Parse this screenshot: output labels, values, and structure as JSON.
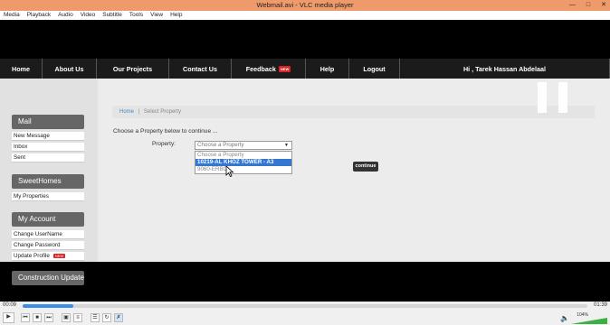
{
  "window": {
    "title": "Webmail.avi - VLC media player",
    "min_icon": "minimize-icon",
    "max_icon": "maximize-icon",
    "close_icon": "close-icon"
  },
  "menubar": [
    "Media",
    "Playback",
    "Audio",
    "Video",
    "Subtitle",
    "Tools",
    "View",
    "Help"
  ],
  "site": {
    "nav": {
      "home": "Home",
      "about": "About Us",
      "projects": "Our Projects",
      "contact": "Contact Us",
      "feedback": "Feedback",
      "feedback_badge": "NEW",
      "help": "Help",
      "logout": "Logout",
      "greeting": "Hi , Tarek Hassan Abdelaal"
    },
    "sidebar": {
      "mail_head": "Mail",
      "mail_links": [
        "New Message",
        "Inbox",
        "Sent"
      ],
      "homes_head": "SweetHomes",
      "homes_links": [
        "My Properties"
      ],
      "account_head": "My Account",
      "account_links": [
        "Change UserName",
        "Change Password",
        "Update Profile"
      ],
      "update_badge": "NEW",
      "construction_head": "Construction Update"
    },
    "breadcrumb": {
      "home": "Home",
      "sep": "|",
      "current": "Select Property"
    },
    "prompt": "Choose a Property below to continue ...",
    "property_label": "Property:",
    "select_value": "Choose a Property",
    "options": [
      "Choose a Property",
      "10219-AL KHOZ TOWER - A3",
      "9060-ERBC..."
    ],
    "selected_index": 1,
    "continue_label": "continue"
  },
  "player": {
    "elapsed": "00:09",
    "total": "01:39",
    "progress": 0.09,
    "volume_label": "104%",
    "volume": 1.04,
    "buttons": [
      "play-icon",
      "previous-icon",
      "stop-icon",
      "next-icon",
      "fullscreen-icon",
      "extended-settings-icon",
      "playlist-icon",
      "loop-icon",
      "shuffle-icon"
    ],
    "accent": "#3a8ee6"
  },
  "colors": {
    "titlebar": "#ef9a6a",
    "nav_bg": "#1b1b1b",
    "badge_red": "#d8232a",
    "selection_blue": "#3377d2"
  }
}
